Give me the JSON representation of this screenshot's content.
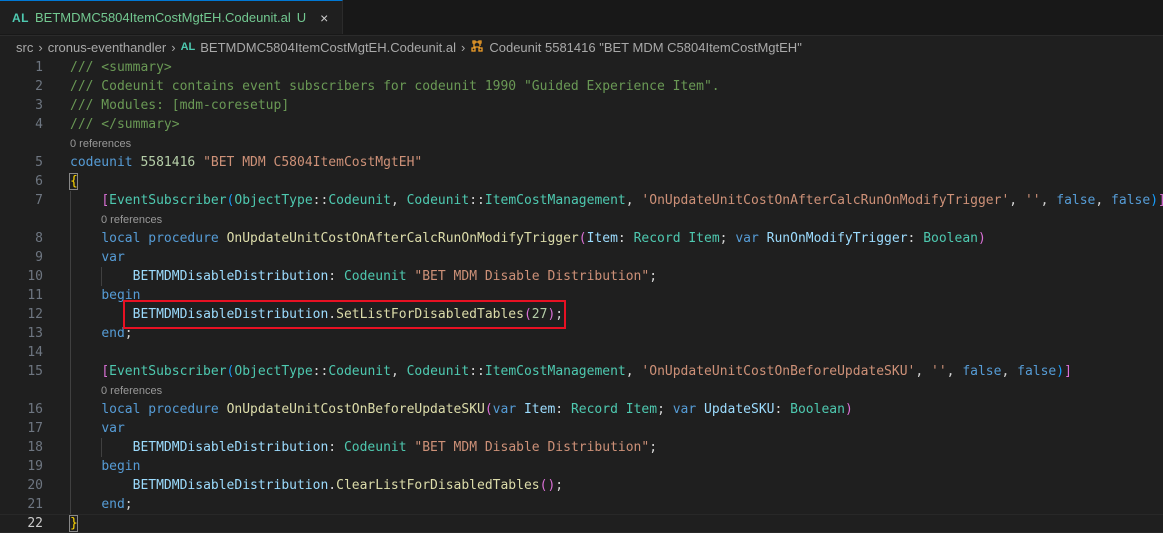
{
  "tab": {
    "file_icon": "AL",
    "title": "BETMDMC5804ItemCostMgtEH.Codeunit.al",
    "status": "U",
    "close_icon": "×"
  },
  "breadcrumb": {
    "items": [
      "src",
      "cronus-eventhandler",
      "BETMDMC5804ItemCostMgtEH.Codeunit.al",
      "Codeunit 5581416 \"BET MDM C5804ItemCostMgtEH\""
    ],
    "file_icon": "AL",
    "symbol_icon": "codeunit-symbol-icon"
  },
  "code_lens": {
    "line5": "0 references",
    "line8": "0 references",
    "line16": "0 references"
  },
  "highlight_color": "#e81123",
  "lines": [
    {
      "n": "1",
      "tokens": [
        {
          "t": "/// <summary>",
          "c": "c-com"
        }
      ]
    },
    {
      "n": "2",
      "tokens": [
        {
          "t": "/// Codeunit contains event subscribers for codeunit 1990 \"Guided Experience Item\".",
          "c": "c-com"
        }
      ]
    },
    {
      "n": "3",
      "tokens": [
        {
          "t": "/// Modules: [mdm-coresetup]",
          "c": "c-com"
        }
      ]
    },
    {
      "n": "4",
      "tokens": [
        {
          "t": "/// </summary>",
          "c": "c-com"
        }
      ]
    },
    {
      "n": "5",
      "tokens": [
        {
          "t": "codeunit",
          "c": "c-kw"
        },
        {
          "t": " ",
          "c": "c-pun"
        },
        {
          "t": "5581416",
          "c": "c-num"
        },
        {
          "t": " ",
          "c": "c-pun"
        },
        {
          "t": "\"BET MDM C5804ItemCostMgtEH\"",
          "c": "c-str"
        }
      ]
    },
    {
      "n": "6",
      "tokens": [
        {
          "t": "{",
          "c": "c-b1"
        }
      ]
    },
    {
      "n": "7",
      "tokens": [
        {
          "t": "    ",
          "c": "c-pun"
        },
        {
          "t": "[",
          "c": "c-b2"
        },
        {
          "t": "EventSubscriber",
          "c": "c-typ"
        },
        {
          "t": "(",
          "c": "c-b3"
        },
        {
          "t": "ObjectType",
          "c": "c-typ"
        },
        {
          "t": "::",
          "c": "c-pun"
        },
        {
          "t": "Codeunit",
          "c": "c-typ"
        },
        {
          "t": ", ",
          "c": "c-pun"
        },
        {
          "t": "Codeunit",
          "c": "c-typ"
        },
        {
          "t": "::",
          "c": "c-pun"
        },
        {
          "t": "ItemCostManagement",
          "c": "c-typ"
        },
        {
          "t": ", ",
          "c": "c-pun"
        },
        {
          "t": "'OnUpdateUnitCostOnAfterCalcRunOnModifyTrigger'",
          "c": "c-str"
        },
        {
          "t": ", ",
          "c": "c-pun"
        },
        {
          "t": "''",
          "c": "c-str"
        },
        {
          "t": ", ",
          "c": "c-pun"
        },
        {
          "t": "false",
          "c": "c-kw"
        },
        {
          "t": ", ",
          "c": "c-pun"
        },
        {
          "t": "false",
          "c": "c-kw"
        },
        {
          "t": ")",
          "c": "c-b3"
        },
        {
          "t": "]",
          "c": "c-b2"
        }
      ]
    },
    {
      "n": "8",
      "tokens": [
        {
          "t": "    ",
          "c": "c-pun"
        },
        {
          "t": "local",
          "c": "c-kw"
        },
        {
          "t": " ",
          "c": "c-pun"
        },
        {
          "t": "procedure",
          "c": "c-kw"
        },
        {
          "t": " ",
          "c": "c-pun"
        },
        {
          "t": "OnUpdateUnitCostOnAfterCalcRunOnModifyTrigger",
          "c": "c-fn"
        },
        {
          "t": "(",
          "c": "c-b2"
        },
        {
          "t": "Item",
          "c": "c-var"
        },
        {
          "t": ": ",
          "c": "c-pun"
        },
        {
          "t": "Record",
          "c": "c-typ"
        },
        {
          "t": " ",
          "c": "c-pun"
        },
        {
          "t": "Item",
          "c": "c-typ"
        },
        {
          "t": "; ",
          "c": "c-pun"
        },
        {
          "t": "var",
          "c": "c-kw"
        },
        {
          "t": " ",
          "c": "c-pun"
        },
        {
          "t": "RunOnModifyTrigger",
          "c": "c-var"
        },
        {
          "t": ": ",
          "c": "c-pun"
        },
        {
          "t": "Boolean",
          "c": "c-typ"
        },
        {
          "t": ")",
          "c": "c-b2"
        }
      ]
    },
    {
      "n": "9",
      "tokens": [
        {
          "t": "    ",
          "c": "c-pun"
        },
        {
          "t": "var",
          "c": "c-kw"
        }
      ]
    },
    {
      "n": "10",
      "tokens": [
        {
          "t": "        ",
          "c": "c-pun"
        },
        {
          "t": "BETMDMDisableDistribution",
          "c": "c-var"
        },
        {
          "t": ": ",
          "c": "c-pun"
        },
        {
          "t": "Codeunit",
          "c": "c-typ"
        },
        {
          "t": " ",
          "c": "c-pun"
        },
        {
          "t": "\"BET MDM Disable Distribution\"",
          "c": "c-str"
        },
        {
          "t": ";",
          "c": "c-pun"
        }
      ]
    },
    {
      "n": "11",
      "tokens": [
        {
          "t": "    ",
          "c": "c-pun"
        },
        {
          "t": "begin",
          "c": "c-kw"
        }
      ]
    },
    {
      "n": "12",
      "tokens": [
        {
          "t": "        ",
          "c": "c-pun"
        },
        {
          "t": "BETMDMDisableDistribution",
          "c": "c-var"
        },
        {
          "t": ".",
          "c": "c-pun"
        },
        {
          "t": "SetListForDisabledTables",
          "c": "c-fn"
        },
        {
          "t": "(",
          "c": "c-b2"
        },
        {
          "t": "27",
          "c": "c-num"
        },
        {
          "t": ")",
          "c": "c-b2"
        },
        {
          "t": ";",
          "c": "c-pun"
        }
      ]
    },
    {
      "n": "13",
      "tokens": [
        {
          "t": "    ",
          "c": "c-pun"
        },
        {
          "t": "end",
          "c": "c-kw"
        },
        {
          "t": ";",
          "c": "c-pun"
        }
      ]
    },
    {
      "n": "14",
      "tokens": []
    },
    {
      "n": "15",
      "tokens": [
        {
          "t": "    ",
          "c": "c-pun"
        },
        {
          "t": "[",
          "c": "c-b2"
        },
        {
          "t": "EventSubscriber",
          "c": "c-typ"
        },
        {
          "t": "(",
          "c": "c-b3"
        },
        {
          "t": "ObjectType",
          "c": "c-typ"
        },
        {
          "t": "::",
          "c": "c-pun"
        },
        {
          "t": "Codeunit",
          "c": "c-typ"
        },
        {
          "t": ", ",
          "c": "c-pun"
        },
        {
          "t": "Codeunit",
          "c": "c-typ"
        },
        {
          "t": "::",
          "c": "c-pun"
        },
        {
          "t": "ItemCostManagement",
          "c": "c-typ"
        },
        {
          "t": ", ",
          "c": "c-pun"
        },
        {
          "t": "'OnUpdateUnitCostOnBeforeUpdateSKU'",
          "c": "c-str"
        },
        {
          "t": ", ",
          "c": "c-pun"
        },
        {
          "t": "''",
          "c": "c-str"
        },
        {
          "t": ", ",
          "c": "c-pun"
        },
        {
          "t": "false",
          "c": "c-kw"
        },
        {
          "t": ", ",
          "c": "c-pun"
        },
        {
          "t": "false",
          "c": "c-kw"
        },
        {
          "t": ")",
          "c": "c-b3"
        },
        {
          "t": "]",
          "c": "c-b2"
        }
      ]
    },
    {
      "n": "16",
      "tokens": [
        {
          "t": "    ",
          "c": "c-pun"
        },
        {
          "t": "local",
          "c": "c-kw"
        },
        {
          "t": " ",
          "c": "c-pun"
        },
        {
          "t": "procedure",
          "c": "c-kw"
        },
        {
          "t": " ",
          "c": "c-pun"
        },
        {
          "t": "OnUpdateUnitCostOnBeforeUpdateSKU",
          "c": "c-fn"
        },
        {
          "t": "(",
          "c": "c-b2"
        },
        {
          "t": "var",
          "c": "c-kw"
        },
        {
          "t": " ",
          "c": "c-pun"
        },
        {
          "t": "Item",
          "c": "c-var"
        },
        {
          "t": ": ",
          "c": "c-pun"
        },
        {
          "t": "Record",
          "c": "c-typ"
        },
        {
          "t": " ",
          "c": "c-pun"
        },
        {
          "t": "Item",
          "c": "c-typ"
        },
        {
          "t": "; ",
          "c": "c-pun"
        },
        {
          "t": "var",
          "c": "c-kw"
        },
        {
          "t": " ",
          "c": "c-pun"
        },
        {
          "t": "UpdateSKU",
          "c": "c-var"
        },
        {
          "t": ": ",
          "c": "c-pun"
        },
        {
          "t": "Boolean",
          "c": "c-typ"
        },
        {
          "t": ")",
          "c": "c-b2"
        }
      ]
    },
    {
      "n": "17",
      "tokens": [
        {
          "t": "    ",
          "c": "c-pun"
        },
        {
          "t": "var",
          "c": "c-kw"
        }
      ]
    },
    {
      "n": "18",
      "tokens": [
        {
          "t": "        ",
          "c": "c-pun"
        },
        {
          "t": "BETMDMDisableDistribution",
          "c": "c-var"
        },
        {
          "t": ": ",
          "c": "c-pun"
        },
        {
          "t": "Codeunit",
          "c": "c-typ"
        },
        {
          "t": " ",
          "c": "c-pun"
        },
        {
          "t": "\"BET MDM Disable Distribution\"",
          "c": "c-str"
        },
        {
          "t": ";",
          "c": "c-pun"
        }
      ]
    },
    {
      "n": "19",
      "tokens": [
        {
          "t": "    ",
          "c": "c-pun"
        },
        {
          "t": "begin",
          "c": "c-kw"
        }
      ]
    },
    {
      "n": "20",
      "tokens": [
        {
          "t": "        ",
          "c": "c-pun"
        },
        {
          "t": "BETMDMDisableDistribution",
          "c": "c-var"
        },
        {
          "t": ".",
          "c": "c-pun"
        },
        {
          "t": "ClearListForDisabledTables",
          "c": "c-fn"
        },
        {
          "t": "(",
          "c": "c-b2"
        },
        {
          "t": ")",
          "c": "c-b2"
        },
        {
          "t": ";",
          "c": "c-pun"
        }
      ]
    },
    {
      "n": "21",
      "tokens": [
        {
          "t": "    ",
          "c": "c-pun"
        },
        {
          "t": "end",
          "c": "c-kw"
        },
        {
          "t": ";",
          "c": "c-pun"
        }
      ]
    },
    {
      "n": "22",
      "tokens": [
        {
          "t": "}",
          "c": "c-b1"
        }
      ]
    }
  ]
}
